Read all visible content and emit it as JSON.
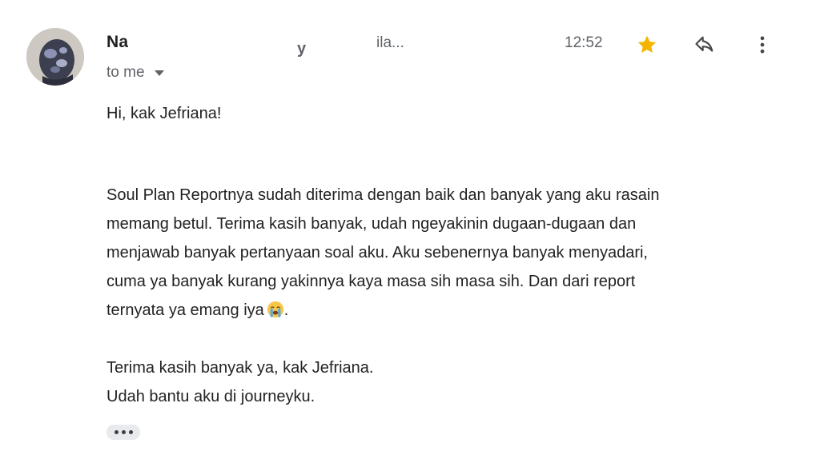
{
  "header": {
    "sender_name": "Na",
    "sender_name_tail": "y",
    "sender_email_fragment": "ila...",
    "time": "12:52",
    "recipient_label": "to me",
    "icons": {
      "avatar": "avatar-photo",
      "star": "star-icon",
      "reply": "reply-icon",
      "more": "more-vertical-icon",
      "recipient_caret": "chevron-down-icon"
    },
    "star_color": "#f4b400"
  },
  "message": {
    "greeting": "Hi, kak Jefriana!",
    "paragraph_lines": [
      "Soul Plan Reportnya sudah diterima dengan baik dan banyak yang aku rasain",
      "memang betul. Terima kasih banyak, udah ngeyakinin dugaan-dugaan dan",
      "menjawab banyak pertanyaan soal aku. Aku sebenernya banyak menyadari,",
      "cuma ya banyak kurang yakinnya kaya masa sih masa sih. Dan dari report",
      "ternyata ya emang iya"
    ],
    "paragraph_end_emoji": "loudly-crying-face-emoji",
    "paragraph_end_punct": ".",
    "closing_lines": [
      "Terima kasih banyak ya, kak Jefriana.",
      "Udah bantu aku di journeyku."
    ],
    "trimmed_content": "show-trimmed-content-icon"
  }
}
